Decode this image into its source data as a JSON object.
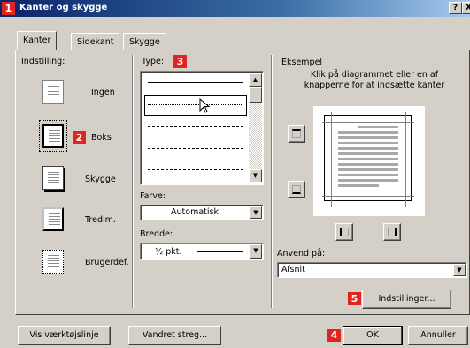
{
  "window": {
    "title": "Kanter og skygge",
    "help_label": "?",
    "close_label": "X"
  },
  "badges": [
    "1",
    "2",
    "3",
    "4",
    "5"
  ],
  "tabs": [
    {
      "label": "Kanter"
    },
    {
      "label": "Sidekant"
    },
    {
      "label": "Skygge"
    }
  ],
  "setting": {
    "header": "Indstilling:",
    "options": [
      {
        "label": "Ingen",
        "icon": "none-border-icon"
      },
      {
        "label": "Boks",
        "icon": "box-border-icon",
        "selected": true
      },
      {
        "label": "Skygge",
        "icon": "shadow-border-icon"
      },
      {
        "label": "Tredim.",
        "icon": "3d-border-icon"
      },
      {
        "label": "Brugerdef.",
        "icon": "custom-border-icon"
      }
    ]
  },
  "style": {
    "header": "Type:",
    "items": [
      "solid",
      "dotted",
      "dashed",
      "long-dash",
      "dash-dot"
    ]
  },
  "color": {
    "label": "Farve:",
    "value": "Automatisk"
  },
  "width": {
    "label": "Bredde:",
    "value": "½ pkt."
  },
  "preview": {
    "header": "Eksempel",
    "instructions": "Klik på diagrammet eller en af knapperne for at indsætte kanter"
  },
  "apply_to": {
    "label": "Anvend på:",
    "value": "Afsnit"
  },
  "buttons": {
    "options": "Indstillinger...",
    "toolbar": "Vis værktøjslinje",
    "horizontal_line": "Vandret streg...",
    "ok": "OK",
    "cancel": "Annuller"
  },
  "colors": {
    "titlebar_start": "#0a246a",
    "titlebar_end": "#a6caf0",
    "badge": "#e02420",
    "face": "#d4d0c8"
  }
}
